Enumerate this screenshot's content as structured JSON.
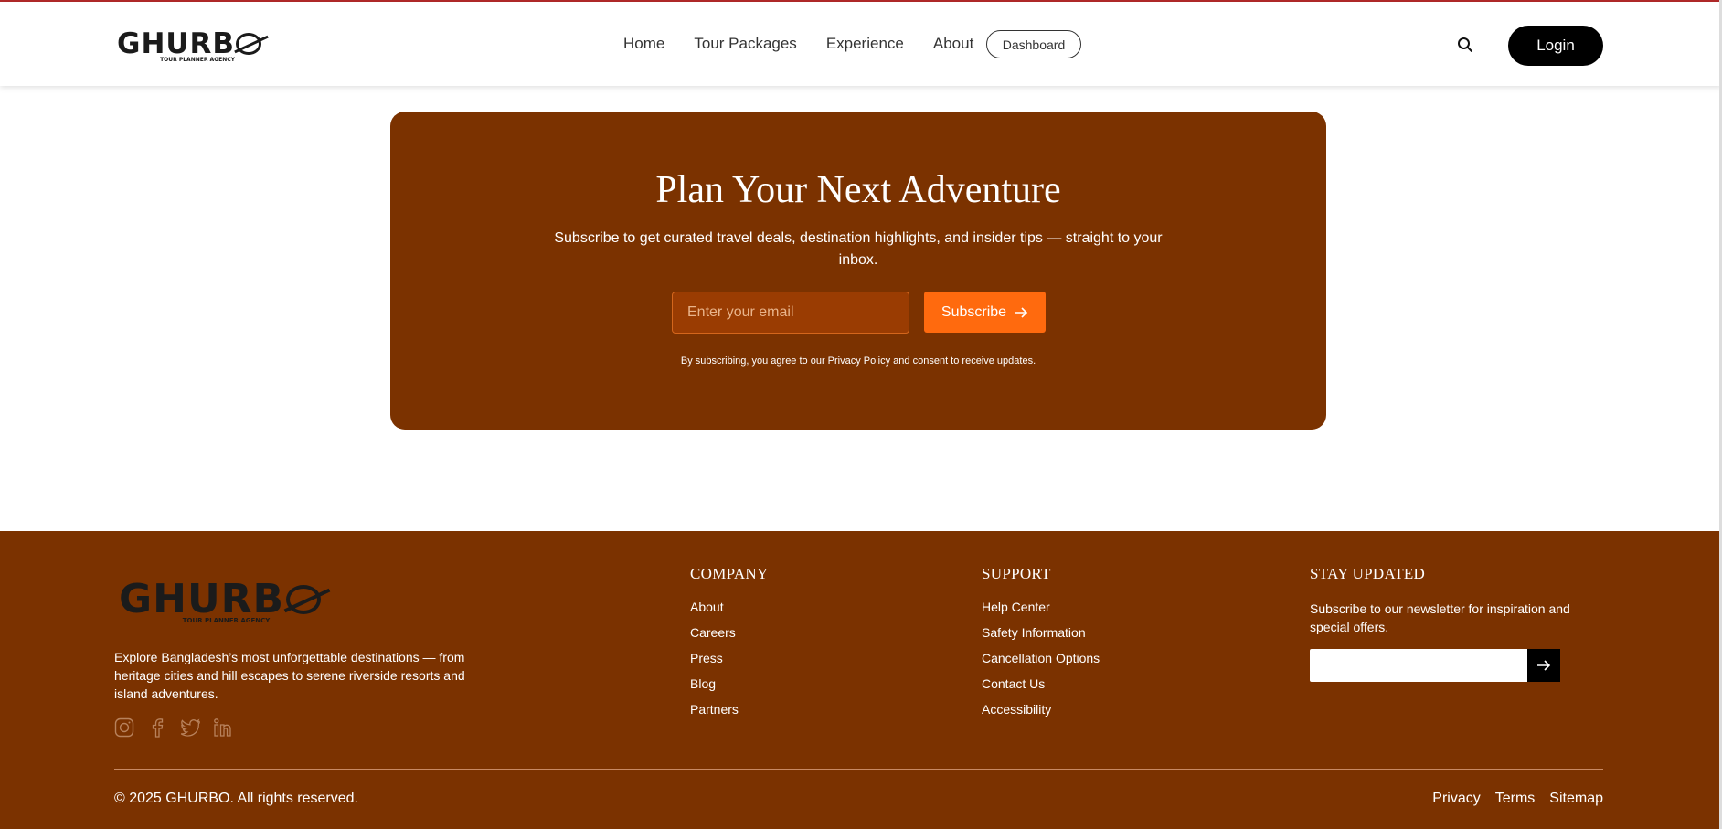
{
  "header": {
    "logo": {
      "word": "GHURB",
      "tagline": "TOUR PLANNER AGENCY"
    },
    "nav": [
      "Home",
      "Tour Packages",
      "Experience",
      "About"
    ],
    "dashboard_label": "Dashboard",
    "search_icon": "search-icon",
    "login_label": "Login"
  },
  "newsletter": {
    "title": "Plan Your Next Adventure",
    "subtitle": "Subscribe to get curated travel deals, destination highlights, and insider tips — straight to your inbox.",
    "email_placeholder": "Enter your email",
    "subscribe_label": "Subscribe",
    "legal": "By subscribing, you agree to our Privacy Policy and consent to receive updates."
  },
  "footer": {
    "logo": {
      "word": "GHURB",
      "tagline": "TOUR PLANNER AGENCY"
    },
    "about": "Explore Bangladesh’s most unforgettable destinations — from heritage cities and hill escapes to serene riverside resorts and island adventures.",
    "socials": [
      "instagram-icon",
      "facebook-icon",
      "twitter-icon",
      "linkedin-icon"
    ],
    "company": {
      "heading": "COMPANY",
      "links": [
        "About",
        "Careers",
        "Press",
        "Blog",
        "Partners"
      ]
    },
    "support": {
      "heading": "SUPPORT",
      "links": [
        "Help Center",
        "Safety Information",
        "Cancellation Options",
        "Contact Us",
        "Accessibility"
      ]
    },
    "stay": {
      "heading": "STAY UPDATED",
      "text": "Subscribe to our newsletter for inspiration and special offers."
    },
    "copyright": "© 2025 GHURBO. All rights reserved.",
    "legal_links": [
      "Privacy",
      "Terms",
      "Sitemap"
    ]
  },
  "colors": {
    "brand_brown": "#7b3200",
    "accent_orange": "#ff6a0e",
    "top_line": "#b22a2a"
  }
}
